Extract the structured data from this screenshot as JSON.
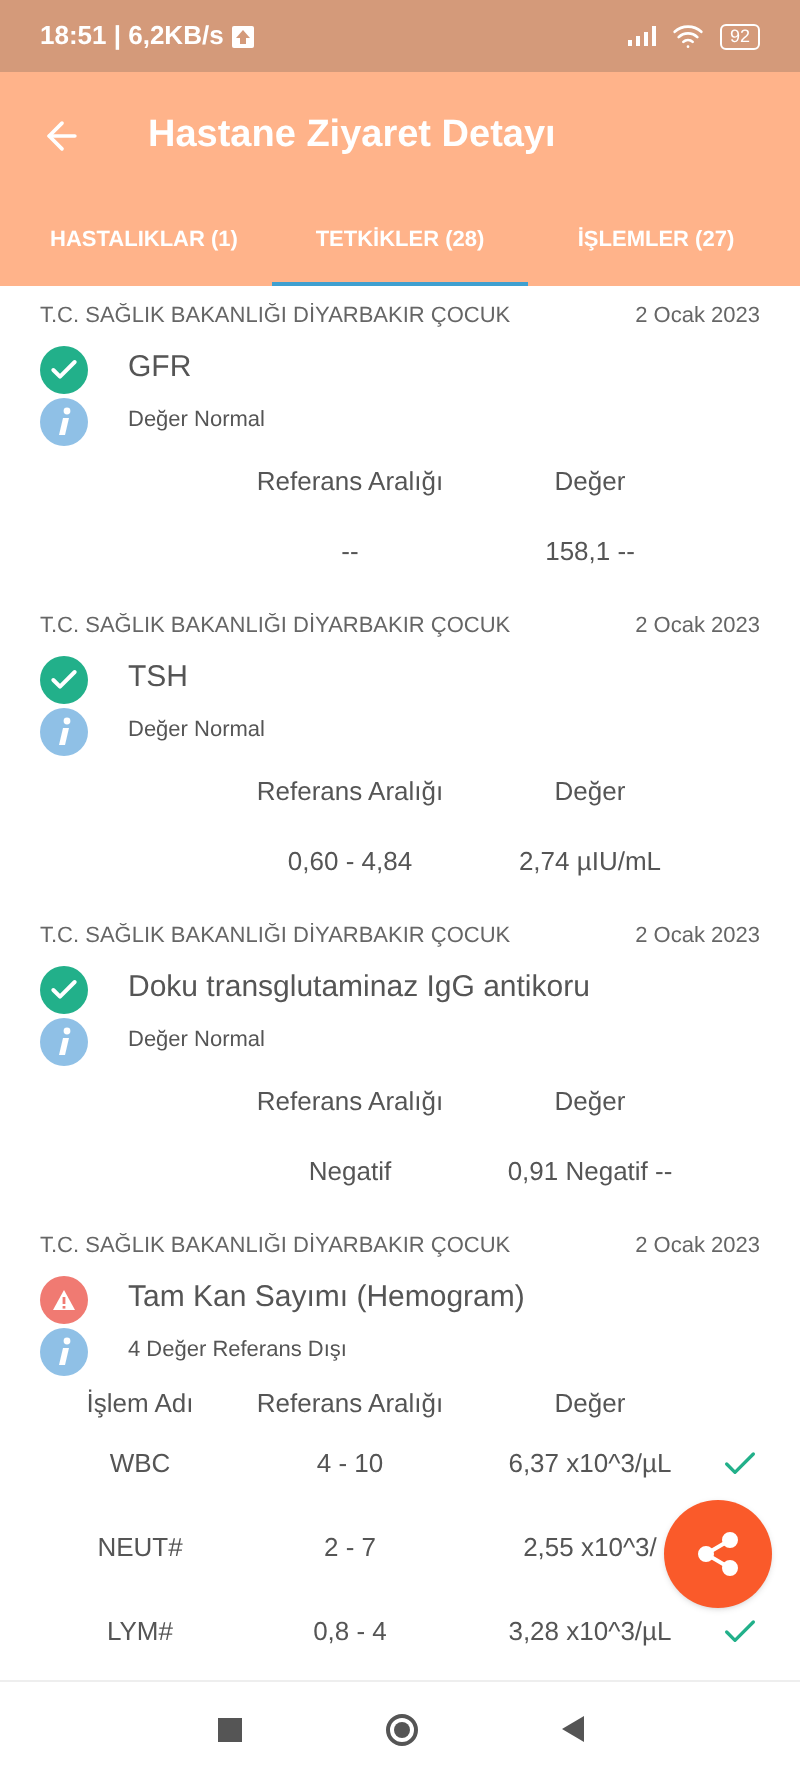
{
  "status_bar": {
    "text": "18:51 | 6,2KB/s",
    "battery": "92"
  },
  "app_bar": {
    "title": "Hastane Ziyaret Detayı"
  },
  "tabs": [
    {
      "label": "HASTALIKLAR (1)",
      "selected": false
    },
    {
      "label": "TETKİKLER (28)",
      "selected": true
    },
    {
      "label": "İŞLEMLER (27)",
      "selected": false
    }
  ],
  "tests": [
    {
      "institution": "T.C. SAĞLIK BAKANLIĞI DİYARBAKIR ÇOCUK",
      "date": "2 Ocak 2023",
      "kind": "ok",
      "name": "GFR",
      "note": "Değer Normal",
      "columns": [
        "Referans Aralığı",
        "Değer"
      ],
      "rows": [
        {
          "cells": [
            "--",
            "158,1 --"
          ]
        }
      ]
    },
    {
      "institution": "T.C. SAĞLIK BAKANLIĞI DİYARBAKIR ÇOCUK",
      "date": "2 Ocak 2023",
      "kind": "ok",
      "name": "TSH",
      "note": "Değer Normal",
      "columns": [
        "Referans Aralığı",
        "Değer"
      ],
      "rows": [
        {
          "cells": [
            "0,60 - 4,84",
            "2,74 µIU/mL"
          ]
        }
      ]
    },
    {
      "institution": "T.C. SAĞLIK BAKANLIĞI DİYARBAKIR ÇOCUK",
      "date": "2 Ocak 2023",
      "kind": "ok",
      "name": "Doku transglutaminaz IgG antikoru",
      "note": "Değer Normal",
      "columns": [
        "Referans Aralığı",
        "Değer"
      ],
      "rows": [
        {
          "cells": [
            "Negatif",
            "0,91 Negatif --"
          ]
        }
      ]
    },
    {
      "institution": "T.C. SAĞLIK BAKANLIĞI DİYARBAKIR ÇOCUK",
      "date": "2 Ocak 2023",
      "kind": "warning",
      "name": "Tam Kan Sayımı (Hemogram)",
      "note": "4 Değer Referans Dışı",
      "columns": [
        "İşlem Adı",
        "Referans Aralığı",
        "Değer"
      ],
      "rows": [
        {
          "cells": [
            "WBC",
            "4 - 10",
            "6,37 x10^3/µL"
          ],
          "normal": true
        },
        {
          "cells": [
            "NEUT#",
            "2 - 7",
            "2,55 x10^3/"
          ]
        },
        {
          "cells": [
            "LYM#",
            "0,8 - 4",
            "3,28 x10^3/µL"
          ],
          "normal": true
        }
      ]
    }
  ]
}
